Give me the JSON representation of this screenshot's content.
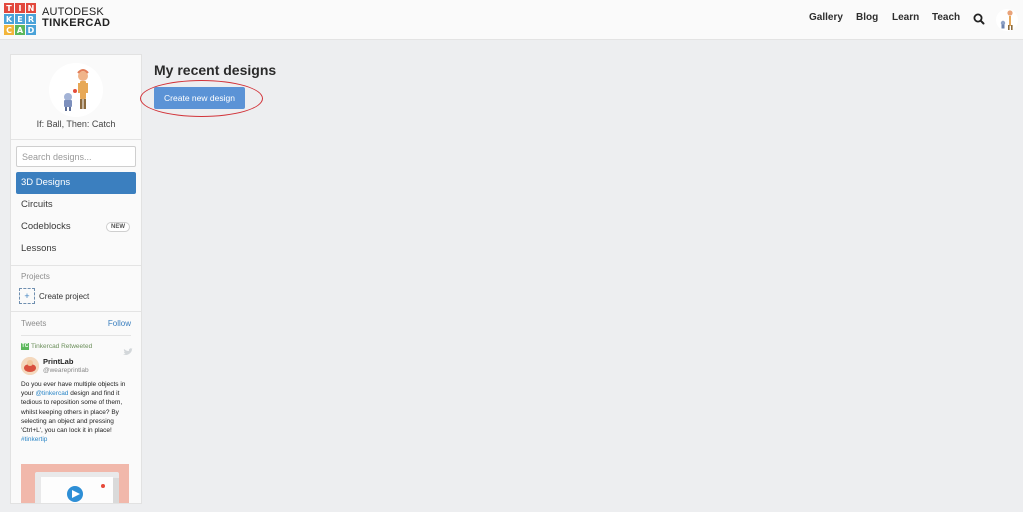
{
  "logo": {
    "letters": [
      "T",
      "I",
      "N",
      "K",
      "E",
      "R",
      "C",
      "A",
      "D"
    ],
    "colors": [
      "#e2483d",
      "#e2483d",
      "#e2483d",
      "#4aa2d8",
      "#4aa2d8",
      "#4aa2d8",
      "#f2b53a",
      "#5cb85c",
      "#4aa2d8"
    ],
    "brand_line1": "AUTODESK",
    "brand_line2": "TINKERCAD"
  },
  "nav": {
    "items": [
      {
        "label": "Gallery"
      },
      {
        "label": "Blog"
      },
      {
        "label": "Learn"
      },
      {
        "label": "Teach"
      }
    ],
    "search_icon": "search-icon",
    "avatar_icon": "user-avatar-icon"
  },
  "profile": {
    "name": "If: Ball, Then: Catch"
  },
  "sidebar": {
    "search_placeholder": "Search designs...",
    "menu": [
      {
        "label": "3D Designs",
        "active": true
      },
      {
        "label": "Circuits"
      },
      {
        "label": "Codeblocks",
        "badge": "NEW"
      },
      {
        "label": "Lessons"
      }
    ],
    "projects_label": "Projects",
    "create_project_label": "Create project",
    "tweets_label": "Tweets",
    "follow_label": "Follow"
  },
  "tweet": {
    "retweet_label": "Tinkercad Retweeted",
    "name": "PrintLab",
    "handle": "@weareprintlab",
    "text_1": "Do you ever have multiple objects in your ",
    "mention": "@tinkercad",
    "text_2": " design and find it tedious to reposition some of them, whilst keeping others in place? By selecting an object and pressing 'Ctrl+L', you can lock it in place!",
    "hashtag": "#tinkertip"
  },
  "main": {
    "title": "My recent designs",
    "create_button": "Create new design"
  },
  "colors": {
    "accent": "#3b7fbf",
    "button": "#5b93d6",
    "annotation": "#d2343a",
    "background": "#edeef0"
  }
}
